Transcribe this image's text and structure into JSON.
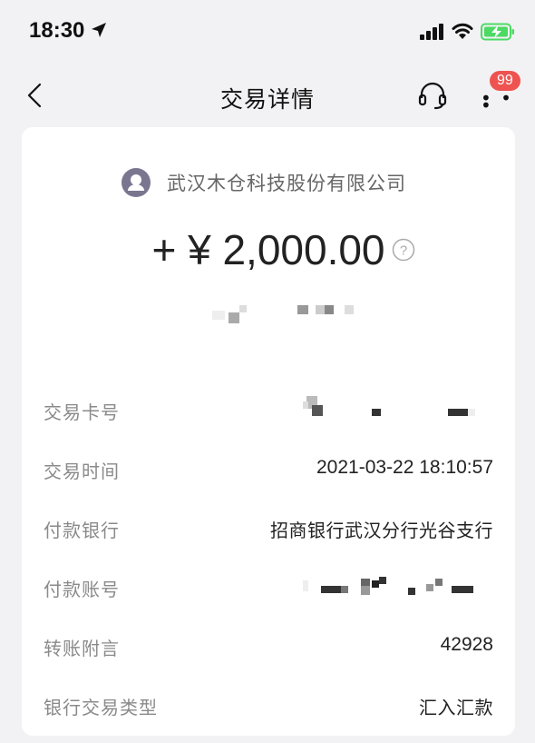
{
  "status_bar": {
    "time": "18:30",
    "icons": [
      "location-arrow-icon",
      "signal-icon",
      "wifi-icon",
      "battery-charging-icon"
    ],
    "battery_color": "#4cd964"
  },
  "nav": {
    "title": "交易详情",
    "back_icon": "chevron-left-icon",
    "support_icon": "headset-icon",
    "more_icon": "more-icon",
    "badge_count": "99",
    "badge_color": "#ee5350"
  },
  "transaction": {
    "merchant": "武汉木仓科技股份有限公司",
    "amount": "+ ¥ 2,000.00",
    "rows": [
      {
        "label": "交易卡号",
        "value": ""
      },
      {
        "label": "交易时间",
        "value": "2021-03-22 18:10:57"
      },
      {
        "label": "付款银行",
        "value": "招商银行武汉分行光谷支行"
      },
      {
        "label": "付款账号",
        "value": ""
      },
      {
        "label": "转账附言",
        "value": "42928"
      },
      {
        "label": "银行交易类型",
        "value": "汇入汇款"
      }
    ]
  }
}
